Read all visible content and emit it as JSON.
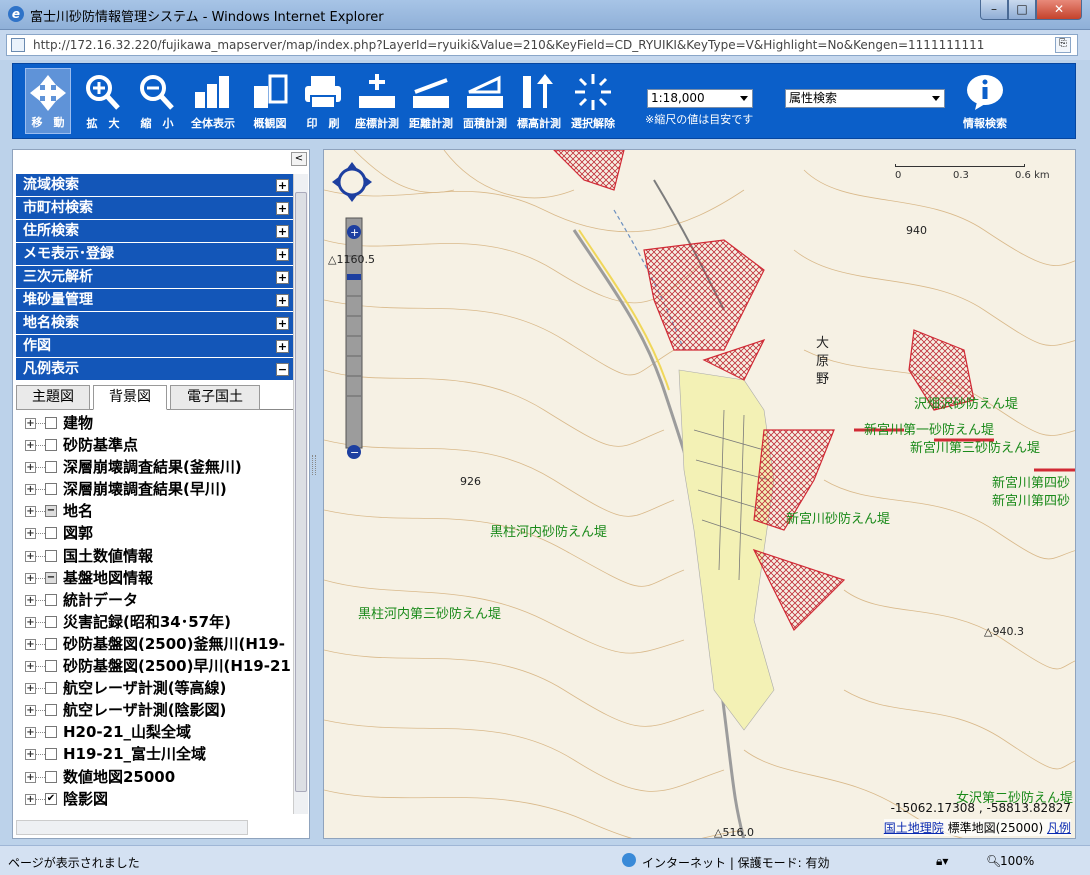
{
  "window": {
    "title": "富士川砂防情報管理システム - Windows Internet Explorer",
    "url": "http://172.16.32.220/fujikawa_mapserver/map/index.php?LayerId=ryuiki&Value=210&KeyField=CD_RYUIKI&KeyType=V&Highlight=No&Kengen=1111111111",
    "min": "–",
    "max": "□",
    "close": "✕"
  },
  "toolbar": {
    "tools": [
      {
        "label": "移　動",
        "icon": "move-icon"
      },
      {
        "label": "拡　大",
        "icon": "zoom-in-icon"
      },
      {
        "label": "縮　小",
        "icon": "zoom-out-icon"
      },
      {
        "label": "全体表示",
        "icon": "full-extent-icon"
      },
      {
        "label": "概観図",
        "icon": "overview-icon"
      },
      {
        "label": "印　刷",
        "icon": "print-icon"
      },
      {
        "label": "座標計測",
        "icon": "coordinate-measure-icon"
      },
      {
        "label": "距離計測",
        "icon": "distance-measure-icon"
      },
      {
        "label": "面積計測",
        "icon": "area-measure-icon"
      },
      {
        "label": "標高計測",
        "icon": "elevation-measure-icon"
      },
      {
        "label": "選択解除",
        "icon": "clear-selection-icon"
      }
    ],
    "scale_value": "1:18,000",
    "scale_note": "※縮尺の値は目安です",
    "attr_search": "属性検索",
    "info_search": "情報検索"
  },
  "left": {
    "collapse": "<",
    "accordion": [
      {
        "label": "流域検索",
        "state": "+"
      },
      {
        "label": "市町村検索",
        "state": "+"
      },
      {
        "label": "住所検索",
        "state": "+"
      },
      {
        "label": "メモ表示･登録",
        "state": "+"
      },
      {
        "label": "三次元解析",
        "state": "+"
      },
      {
        "label": "堆砂量管理",
        "state": "+"
      },
      {
        "label": "地名検索",
        "state": "+"
      },
      {
        "label": "作図",
        "state": "+"
      },
      {
        "label": "凡例表示",
        "state": "−"
      }
    ],
    "tabs": [
      "主題図",
      "背景図",
      "電子国土"
    ],
    "layers": [
      {
        "name": "建物",
        "check": ""
      },
      {
        "name": "砂防基準点",
        "check": ""
      },
      {
        "name": "深層崩壊調査結果(釜無川)",
        "check": ""
      },
      {
        "name": "深層崩壊調査結果(早川)",
        "check": ""
      },
      {
        "name": "地名",
        "check": "−"
      },
      {
        "name": "図郭",
        "check": ""
      },
      {
        "name": "国土数値情報",
        "check": ""
      },
      {
        "name": "基盤地図情報",
        "check": "−"
      },
      {
        "name": "統計データ",
        "check": ""
      },
      {
        "name": "災害記録(昭和34･57年)",
        "check": ""
      },
      {
        "name": "砂防基盤図(2500)釜無川(H19-",
        "check": ""
      },
      {
        "name": "砂防基盤図(2500)早川(H19-21",
        "check": ""
      },
      {
        "name": "航空レーザ計測(等高線)",
        "check": ""
      },
      {
        "name": "航空レーザ計測(陰影図)",
        "check": ""
      },
      {
        "name": "H20-21_山梨全域",
        "check": ""
      },
      {
        "name": "H19-21_富士川全域",
        "check": ""
      },
      {
        "name": "数値地図25000",
        "check": ""
      },
      {
        "name": "陰影図",
        "check": "✔"
      }
    ]
  },
  "map": {
    "scale_ticks": [
      "0",
      "0.3",
      "0.6 km"
    ],
    "labels": [
      {
        "text": "沢畑沢砂防えん堤",
        "cls": "green"
      },
      {
        "text": "新宮川第一砂防えん堤",
        "cls": "green"
      },
      {
        "text": "新宮川第三砂防えん堤",
        "cls": "green"
      },
      {
        "text": "新宮川第四砂",
        "cls": "green"
      },
      {
        "text": "新宮川第四砂",
        "cls": "green"
      },
      {
        "text": "新宮川砂防えん堤",
        "cls": "green"
      },
      {
        "text": "黒柱河内砂防えん堤",
        "cls": "green"
      },
      {
        "text": "黒柱河内第三砂防えん堤",
        "cls": "green"
      },
      {
        "text": "女沢第二砂防えん堤",
        "cls": "green"
      },
      {
        "text": "大",
        "cls": "black"
      },
      {
        "text": "原",
        "cls": "black"
      },
      {
        "text": "野",
        "cls": "black"
      },
      {
        "text": "940",
        "cls": "black"
      },
      {
        "text": "926",
        "cls": "black"
      },
      {
        "text": "△940.3",
        "cls": "black"
      },
      {
        "text": "△1160.5",
        "cls": "black"
      },
      {
        "text": "△516.0",
        "cls": "black"
      }
    ],
    "coords": "-15062.17308 , -58813.82827",
    "credit_link": "国土地理院",
    "credit_text": " 標準地図(25000) ",
    "legend_link": "凡例"
  },
  "status": {
    "text": "ページが表示されました",
    "zone": "インターネット | 保護モード: 有効",
    "zoom": "100%"
  }
}
